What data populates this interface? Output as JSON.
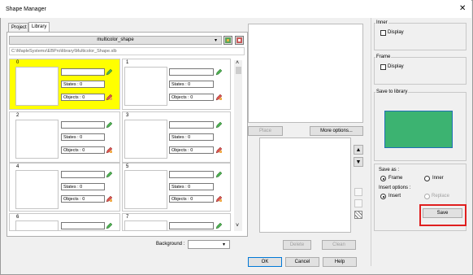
{
  "window": {
    "title": "Shape Manager",
    "close_glyph": "✕"
  },
  "tabs": [
    {
      "label": "Project"
    },
    {
      "label": "Library"
    }
  ],
  "library": {
    "name": "multicolor_shape",
    "path": "C:\\MapleSystems\\EBPro\\library\\Multicolor_Shape.slb",
    "cells": [
      {
        "index": "0",
        "states": "States : 0",
        "objects": "Objects : 0",
        "selected": true
      },
      {
        "index": "1",
        "states": "States : 0",
        "objects": "Objects : 0",
        "selected": false
      },
      {
        "index": "2",
        "states": "States : 0",
        "objects": "Objects : 0",
        "selected": false
      },
      {
        "index": "3",
        "states": "States : 0",
        "objects": "Objects : 0",
        "selected": false
      },
      {
        "index": "4",
        "states": "States : 0",
        "objects": "Objects : 0",
        "selected": false
      },
      {
        "index": "5",
        "states": "States : 0",
        "objects": "Objects : 0",
        "selected": false
      },
      {
        "index": "6",
        "selected": false
      },
      {
        "index": "7",
        "selected": false
      }
    ],
    "background_label": "Background :"
  },
  "middle": {
    "place_label": "Place",
    "more_options_label": "More options...",
    "delete_label": "Delete",
    "clean_label": "Clean"
  },
  "right": {
    "inner": {
      "title": "Inner",
      "display_label": "Display"
    },
    "frame": {
      "title": "Frame",
      "display_label": "Display"
    },
    "save_to_library": {
      "title": "Save to library",
      "preview_color": "#3cb371",
      "preview_border": "#1f6fb5"
    },
    "save_as": {
      "title": "Save as :",
      "frame_label": "Frame",
      "inner_label": "Inner",
      "selected": "Frame"
    },
    "insert_options": {
      "title": "Insert options :",
      "insert_label": "Insert",
      "replace_label": "Replace",
      "selected": "Insert"
    },
    "save_label": "Save"
  },
  "footer": {
    "ok_label": "OK",
    "cancel_label": "Cancel",
    "help_label": "Help"
  },
  "colors": {
    "selected_cell": "#ffff00",
    "highlight": "#e01f1f"
  }
}
